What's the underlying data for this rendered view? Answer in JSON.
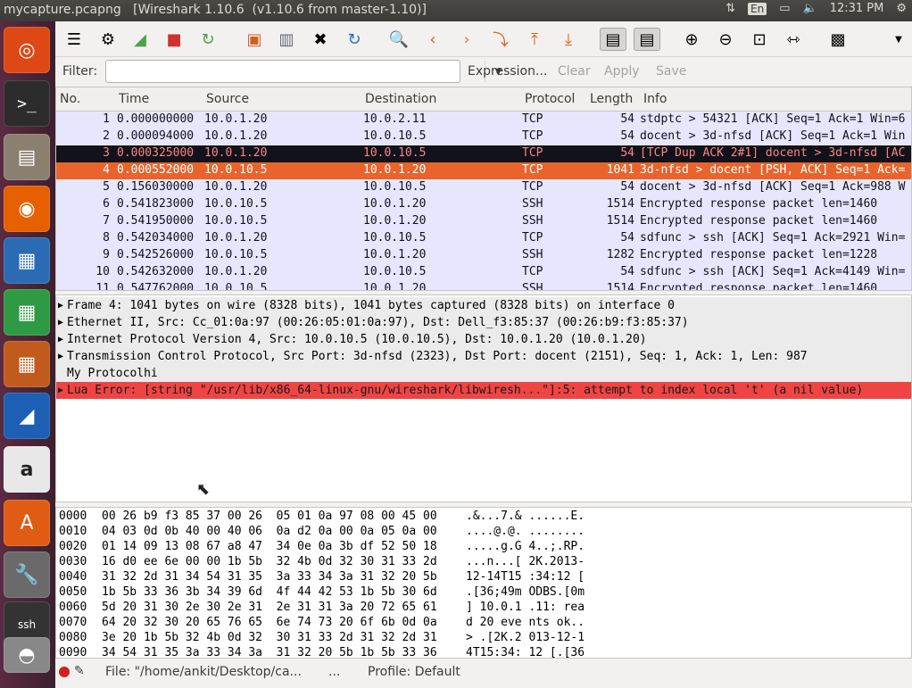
{
  "window": {
    "title": "mycapture.pcapng   [Wireshark 1.10.6  (v1.10.6 from master-1.10)]"
  },
  "system_tray": {
    "lang": "En",
    "time": "12:31 PM"
  },
  "launcher": {
    "items": [
      "ubuntu-dash-icon",
      "terminal-icon",
      "files-icon",
      "firefox-icon",
      "writer-icon",
      "calc-icon",
      "impress-icon",
      "wireshark-icon",
      "amazon-icon",
      "software-center-icon",
      "system-settings-icon",
      "ssh-terminal-icon",
      "disk-icon"
    ]
  },
  "toolbar": {
    "icons": [
      "interfaces-icon",
      "options-icon",
      "start-capture-icon",
      "stop-capture-icon",
      "restart-capture-icon",
      "open-icon",
      "save-icon",
      "close-icon",
      "reload-icon",
      "find-icon",
      "back-icon",
      "forward-icon",
      "go-to-icon",
      "first-icon",
      "last-icon",
      "colorize-icon",
      "autoscroll-icon",
      "zoom-in-icon",
      "zoom-out-icon",
      "normal-size-icon",
      "resize-columns-icon",
      "preferences-icon",
      "more-icon"
    ]
  },
  "filter": {
    "label": "Filter:",
    "value": "",
    "expression": "Expression...",
    "clear": "Clear",
    "apply": "Apply",
    "save": "Save"
  },
  "packet_list": {
    "columns": [
      "No.",
      "Time",
      "Source",
      "Destination",
      "Protocol",
      "Length",
      "Info"
    ],
    "rows": [
      {
        "no": "1",
        "time": "0.000000000",
        "src": "10.0.1.20",
        "dst": "10.0.2.11",
        "proto": "TCP",
        "len": "54",
        "info": "stdptc > 54321 [ACK] Seq=1 Ack=1 Win=6",
        "style": "tcp"
      },
      {
        "no": "2",
        "time": "0.000094000",
        "src": "10.0.1.20",
        "dst": "10.0.10.5",
        "proto": "TCP",
        "len": "54",
        "info": "docent > 3d-nfsd [ACK] Seq=1 Ack=1 Win",
        "style": "tcp"
      },
      {
        "no": "3",
        "time": "0.000325000",
        "src": "10.0.1.20",
        "dst": "10.0.10.5",
        "proto": "TCP",
        "len": "54",
        "info": "[TCP Dup ACK 2#1] docent > 3d-nfsd [AC",
        "style": "bad"
      },
      {
        "no": "4",
        "time": "0.000552000",
        "src": "10.0.10.5",
        "dst": "10.0.1.20",
        "proto": "TCP",
        "len": "1041",
        "info": "3d-nfsd > docent [PSH, ACK] Seq=1 Ack=",
        "style": "selected"
      },
      {
        "no": "5",
        "time": "0.156030000",
        "src": "10.0.1.20",
        "dst": "10.0.10.5",
        "proto": "TCP",
        "len": "54",
        "info": "docent > 3d-nfsd [ACK] Seq=1 Ack=988 W",
        "style": "tcp"
      },
      {
        "no": "6",
        "time": "0.541823000",
        "src": "10.0.10.5",
        "dst": "10.0.1.20",
        "proto": "SSH",
        "len": "1514",
        "info": "Encrypted response packet len=1460",
        "style": "tcp"
      },
      {
        "no": "7",
        "time": "0.541950000",
        "src": "10.0.10.5",
        "dst": "10.0.1.20",
        "proto": "SSH",
        "len": "1514",
        "info": "Encrypted response packet len=1460",
        "style": "tcp"
      },
      {
        "no": "8",
        "time": "0.542034000",
        "src": "10.0.1.20",
        "dst": "10.0.10.5",
        "proto": "TCP",
        "len": "54",
        "info": "sdfunc > ssh [ACK] Seq=1 Ack=2921 Win=",
        "style": "tcp"
      },
      {
        "no": "9",
        "time": "0.542526000",
        "src": "10.0.10.5",
        "dst": "10.0.1.20",
        "proto": "SSH",
        "len": "1282",
        "info": "Encrypted response packet len=1228",
        "style": "tcp"
      },
      {
        "no": "10",
        "time": "0.542632000",
        "src": "10.0.1.20",
        "dst": "10.0.10.5",
        "proto": "TCP",
        "len": "54",
        "info": "sdfunc > ssh [ACK] Seq=1 Ack=4149 Win=",
        "style": "tcp"
      },
      {
        "no": "11",
        "time": "0.547762000",
        "src": "10.0.10.5",
        "dst": "10.0.1.20",
        "proto": "SSH",
        "len": "1514",
        "info": "Encrypted response packet len=1460",
        "style": "tcp"
      }
    ]
  },
  "details": {
    "rows": [
      {
        "text": "Frame 4: 1041 bytes on wire (8328 bits), 1041 bytes captured (8328 bits) on interface 0",
        "arrow": true,
        "style": "gray"
      },
      {
        "text": "Ethernet II, Src: Cc_01:0a:97 (00:26:05:01:0a:97), Dst: Dell_f3:85:37 (00:26:b9:f3:85:37)",
        "arrow": true,
        "style": "gray"
      },
      {
        "text": "Internet Protocol Version 4, Src: 10.0.10.5 (10.0.10.5), Dst: 10.0.1.20 (10.0.1.20)",
        "arrow": true,
        "style": "gray"
      },
      {
        "text": "Transmission Control Protocol, Src Port: 3d-nfsd (2323), Dst Port: docent (2151), Seq: 1, Ack: 1, Len: 987",
        "arrow": true,
        "style": "gray"
      },
      {
        "text": "My Protocolhi",
        "arrow": false,
        "style": "gray"
      },
      {
        "text": "Lua Error: [string \"/usr/lib/x86_64-linux-gnu/wireshark/libwiresh...\"]:5: attempt to index local 't' (a nil value)",
        "arrow": true,
        "style": "err"
      }
    ]
  },
  "hex": {
    "rows": [
      {
        "off": "0000",
        "bytes": "00 26 b9 f3 85 37 00 26  05 01 0a 97 08 00 45 00",
        "ascii": ".&...7.& ......E."
      },
      {
        "off": "0010",
        "bytes": "04 03 0d 0b 40 00 40 06  0a d2 0a 00 0a 05 0a 00",
        "ascii": "....@.@. ........"
      },
      {
        "off": "0020",
        "bytes": "01 14 09 13 08 67 a8 47  34 0e 0a 3b df 52 50 18",
        "ascii": ".....g.G 4..;.RP."
      },
      {
        "off": "0030",
        "bytes": "16 d0 ee 6e 00 00 1b 5b  32 4b 0d 32 30 31 33 2d",
        "ascii": "...n...[ 2K.2013-"
      },
      {
        "off": "0040",
        "bytes": "31 32 2d 31 34 54 31 35  3a 33 34 3a 31 32 20 5b",
        "ascii": "12-14T15 :34:12 ["
      },
      {
        "off": "0050",
        "bytes": "1b 5b 33 36 3b 34 39 6d  4f 44 42 53 1b 5b 30 6d",
        "ascii": ".[36;49m ODBS.[0m"
      },
      {
        "off": "0060",
        "bytes": "5d 20 31 30 2e 30 2e 31  2e 31 31 3a 20 72 65 61",
        "ascii": "] 10.0.1 .11: rea"
      },
      {
        "off": "0070",
        "bytes": "64 20 32 30 20 65 76 65  6e 74 73 20 6f 6b 0d 0a",
        "ascii": "d 20 eve nts ok.."
      },
      {
        "off": "0080",
        "bytes": "3e 20 1b 5b 32 4b 0d 32  30 31 33 2d 31 32 2d 31",
        "ascii": "> .[2K.2 013-12-1"
      },
      {
        "off": "0090",
        "bytes": "34 54 31 35 3a 33 34 3a  31 32 20 5b 1b 5b 33 36",
        "ascii": "4T15:34: 12 [.[36"
      }
    ]
  },
  "status": {
    "file": "File: \"/home/ankit/Desktop/ca...",
    "ellipsis": "...",
    "profile": "Profile: Default"
  },
  "colors": {
    "tcp_row": "#e7e6ff",
    "bad_row": "#12121a",
    "bad_text": "#f78787",
    "selected_row": "#e8642c",
    "error": "#ef4444"
  }
}
